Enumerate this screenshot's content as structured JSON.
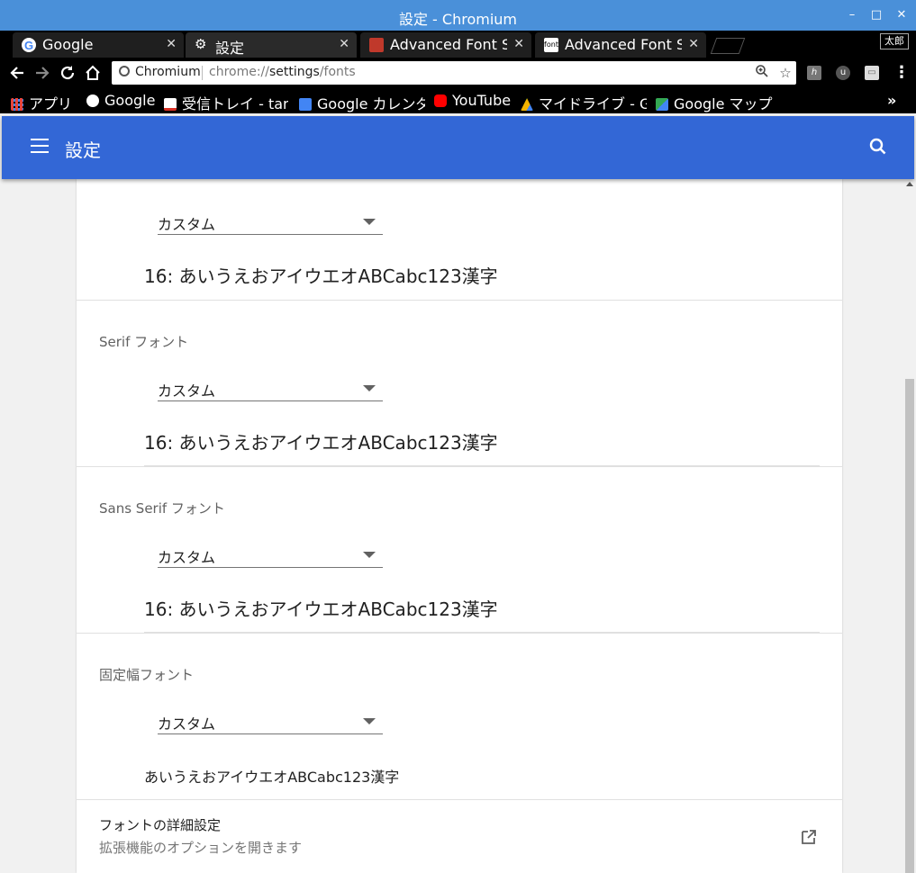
{
  "window": {
    "title": "設定 - Chromium"
  },
  "tabs": [
    {
      "label": "Google",
      "icon": "google-icon",
      "active": false
    },
    {
      "label": "設定",
      "icon": "gear-icon",
      "active": true
    },
    {
      "label": "Advanced Font Se",
      "icon": "extension-icon",
      "active": false
    },
    {
      "label": "Advanced Font Se",
      "icon": "font-icon",
      "active": false
    }
  ],
  "profile": {
    "name": "太郎"
  },
  "omnibox": {
    "chip": "Chromium",
    "url_prefix": "chrome://",
    "url_host": "settings",
    "url_path": "/fonts"
  },
  "bookmarks": [
    {
      "label": "アプリ",
      "icon": "apps-grid-icon",
      "color": "#e8453c"
    },
    {
      "label": "Google",
      "icon": "google-icon",
      "color": "#4285f4"
    },
    {
      "label": "受信トレイ - tar",
      "icon": "gmail-icon",
      "color": "#d93025"
    },
    {
      "label": "Google カレンダ",
      "icon": "calendar-icon",
      "color": "#4285f4"
    },
    {
      "label": "YouTube",
      "icon": "youtube-icon",
      "color": "#ff0000"
    },
    {
      "label": "マイドライブ - G",
      "icon": "drive-icon",
      "color": "#f4b400"
    },
    {
      "label": "Google マップ",
      "icon": "maps-icon",
      "color": "#34a853"
    }
  ],
  "header": {
    "title": "設定"
  },
  "font_sections": [
    {
      "title": "Serif フォント",
      "selected": "カスタム",
      "sample": "16: あいうえおアイウエオABCabc123漢字"
    },
    {
      "title": "Sans Serif フォント",
      "selected": "カスタム",
      "sample": "16: あいうえおアイウエオABCabc123漢字"
    },
    {
      "title": "固定幅フォント",
      "selected": "カスタム",
      "sample": "あいうえおアイウエオABCabc123漢字"
    }
  ],
  "partial_section": {
    "selected": "カスタム",
    "sample": "16: あいうえおアイウエオABCabc123漢字"
  },
  "advanced": {
    "title": "フォントの詳細設定",
    "subtitle": "拡張機能のオプションを開きます"
  }
}
